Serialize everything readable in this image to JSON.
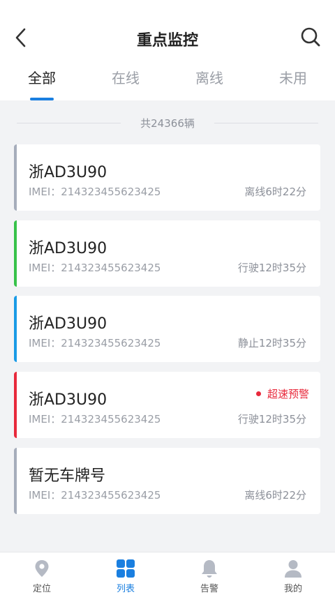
{
  "header": {
    "title": "重点监控",
    "back_icon": "back-arrow-icon",
    "search_icon": "search-icon"
  },
  "tabs": [
    {
      "label": "全部",
      "active": true
    },
    {
      "label": "在线",
      "active": false
    },
    {
      "label": "离线",
      "active": false
    },
    {
      "label": "未用",
      "active": false
    }
  ],
  "summary": {
    "count_text": "共24366辆"
  },
  "vehicles": [
    {
      "plate": "浙AD3U90",
      "imei": "IMEI：214323455623425",
      "status": "离线6时22分",
      "alert": "",
      "bar_color": "#a6adbb"
    },
    {
      "plate": "浙AD3U90",
      "imei": "IMEI：214323455623425",
      "status": "行驶12时35分",
      "alert": "",
      "bar_color": "#37c24a"
    },
    {
      "plate": "浙AD3U90",
      "imei": "IMEI：214323455623425",
      "status": "静止12时35分",
      "alert": "",
      "bar_color": "#1a9be6"
    },
    {
      "plate": "浙AD3U90",
      "imei": "IMEI：214323455623425",
      "status": "行驶12时35分",
      "alert": "超速预警",
      "bar_color": "#e8293b"
    },
    {
      "plate": "暂无车牌号",
      "imei": "IMEI：214323455623425",
      "status": "离线6时22分",
      "alert": "",
      "bar_color": "#a6adbb"
    }
  ],
  "bottom_nav": [
    {
      "label": "定位",
      "icon": "location-pin-icon",
      "active": false
    },
    {
      "label": "列表",
      "icon": "grid-list-icon",
      "active": true
    },
    {
      "label": "告警",
      "icon": "bell-icon",
      "active": false
    },
    {
      "label": "我的",
      "icon": "user-icon",
      "active": false
    }
  ],
  "colors": {
    "accent": "#1a7fe0",
    "alert": "#e8293b",
    "background": "#f2f3f5"
  }
}
